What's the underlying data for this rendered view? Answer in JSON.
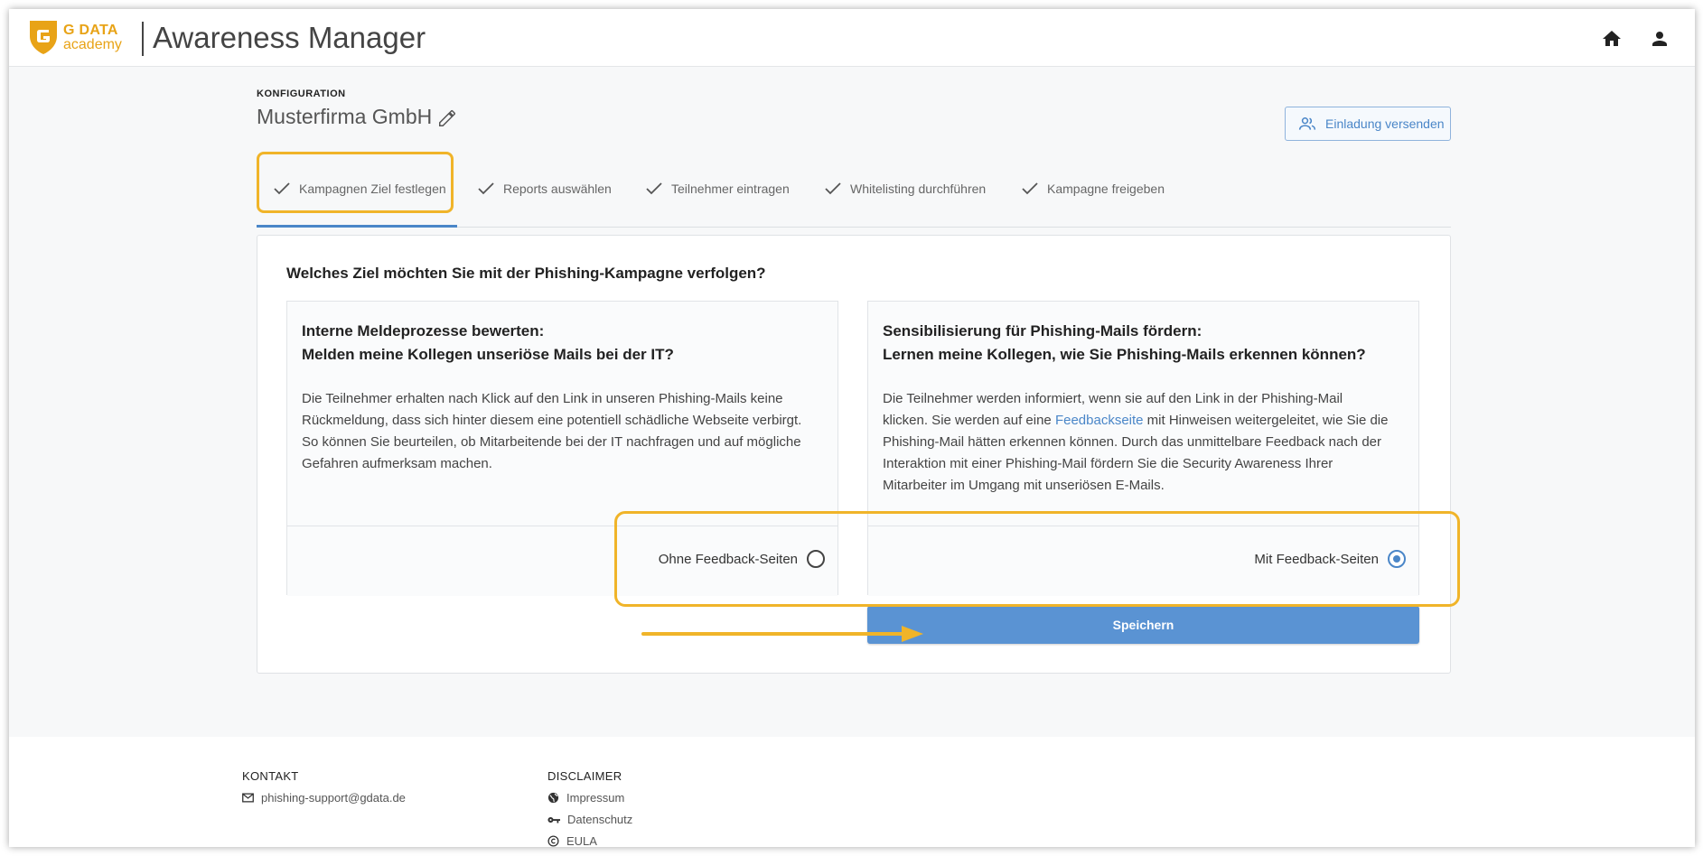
{
  "header": {
    "logo_line1": "G DATA",
    "logo_line2": "academy",
    "app_title": "Awareness Manager",
    "home_icon": "home-icon",
    "user_icon": "user-icon"
  },
  "config": {
    "section_label": "KONFIGURATION",
    "company_name": "Musterfirma GmbH",
    "invite_label": "Einladung versenden"
  },
  "steps": [
    {
      "label": "Kampagnen Ziel festlegen",
      "done": true,
      "active": true
    },
    {
      "label": "Reports auswählen",
      "done": true,
      "active": false
    },
    {
      "label": "Teilnehmer eintragen",
      "done": true,
      "active": false
    },
    {
      "label": "Whitelisting durchführen",
      "done": true,
      "active": false
    },
    {
      "label": "Kampagne freigeben",
      "done": true,
      "active": false
    }
  ],
  "card": {
    "question": "Welches Ziel möchten Sie mit der Phishing-Kampagne verfolgen?",
    "option_left": {
      "title_line1": "Interne Meldeprozesse bewerten:",
      "title_line2": "Melden meine Kollegen unseriöse Mails bei der IT?",
      "desc_line1": "Die Teilnehmer erhalten nach Klick auf den Link in unseren Phishing-Mails keine",
      "desc_line2": "Rückmeldung, dass sich hinter diesem eine potentiell schädliche Webseite verbirgt.",
      "desc_line3": "So können Sie beurteilen, ob Mitarbeitende bei der IT nachfragen und auf mögliche",
      "desc_line4": "Gefahren aufmerksam machen.",
      "radio_label": "Ohne Feedback-Seiten",
      "selected": false
    },
    "option_right": {
      "title_line1": "Sensibilisierung für Phishing-Mails fördern:",
      "title_line2": "Lernen meine Kollegen, wie Sie Phishing-Mails erkennen können?",
      "desc_line1": "Die Teilnehmer werden informiert, wenn sie auf den Link in der Phishing-Mail",
      "desc_line2_pre": "klicken. Sie werden auf eine ",
      "desc_link": "Feedbackseite",
      "desc_line2_post": " mit Hinweisen weitergeleitet, wie Sie die",
      "desc_line3": "Phishing-Mail hätten erkennen können. Durch das unmittelbare Feedback nach der",
      "desc_line4": "Interaktion mit einer Phishing-Mail fördern Sie die Security Awareness Ihrer",
      "desc_line5": "Mitarbeiter im Umgang mit unseriösen E-Mails.",
      "radio_label": "Mit Feedback-Seiten",
      "selected": true
    },
    "save_label": "Speichern"
  },
  "footer": {
    "contact_heading": "KONTAKT",
    "contact_email": "phishing-support@gdata.de",
    "disclaimer_heading": "DISCLAIMER",
    "impressum": "Impressum",
    "datenschutz": "Datenschutz",
    "eula": "EULA"
  },
  "colors": {
    "accent": "#4a86c8",
    "brand": "#e8a317",
    "highlight": "#f0b429",
    "save_button": "#5a93d3"
  }
}
